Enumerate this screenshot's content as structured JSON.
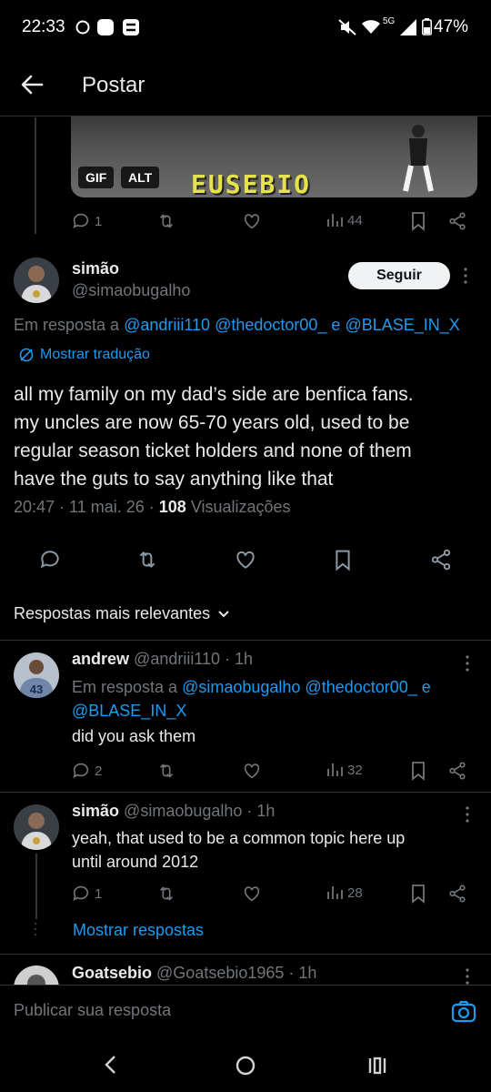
{
  "status_bar": {
    "time": "22:33",
    "network": "5G",
    "battery": "47%"
  },
  "header": {
    "title": "Postar"
  },
  "media": {
    "badge_gif": "GIF",
    "badge_alt": "ALT",
    "caption": "EUSEBIO"
  },
  "prev_tweet_actions": {
    "replies": "1",
    "views": "44"
  },
  "main_tweet": {
    "display_name": "simão",
    "handle": "@simaobugalho",
    "follow_label": "Seguir",
    "reply_prefix": "Em resposta a",
    "reply_users": "@andriii110 @thedoctor00_ e @BLASE_IN_X",
    "translate_label": "Mostrar tradução",
    "text_lines": [
      "all my family on my dad’s side are benfica fans.",
      "my uncles are now 65-70 years old, used to be",
      "regular season ticket holders and none of them",
      "have the guts to say anything like that"
    ],
    "timestamp": "20:47 · 11 mai. 26 ·",
    "views_count": "108",
    "views_label": "Visualizações"
  },
  "sort_label": "Respostas mais relevantes",
  "replies": [
    {
      "display_name": "andrew",
      "meta": "@andriii110 · 1h",
      "reply_prefix": "Em resposta a",
      "reply_users_line1": "@simaobugalho @thedoctor00_ e",
      "reply_users_line2": "@BLASE_IN_X",
      "text": "did you ask them",
      "replies": "2",
      "views": "32"
    },
    {
      "display_name": "simão",
      "meta": "@simaobugalho · 1h",
      "text_line1": "yeah, that used to be a common topic here up",
      "text_line2": "until around 2012",
      "replies": "1",
      "views": "28"
    }
  ],
  "show_replies_label": "Mostrar respostas",
  "partial_reply": {
    "display_name": "Goatsebio",
    "meta": "@Goatsebio1965 · 1h"
  },
  "compose": {
    "placeholder": "Publicar sua resposta"
  }
}
